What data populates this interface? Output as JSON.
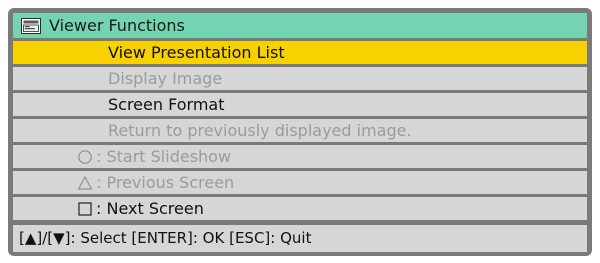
{
  "title_bar": {
    "title": "Viewer Functions",
    "icon": "viewer-icon"
  },
  "menu": {
    "items": [
      {
        "label": "View Presentation List",
        "state": "selected"
      },
      {
        "label": "Display Image",
        "state": "disabled"
      },
      {
        "label": "Screen Format",
        "state": "enabled"
      },
      {
        "label": "Return to previously displayed image.",
        "state": "disabled"
      },
      {
        "button_icon": "circle-button-icon",
        "label": ": Start Slideshow",
        "state": "disabled"
      },
      {
        "button_icon": "triangle-button-icon",
        "label": ": Previous Screen",
        "state": "disabled"
      },
      {
        "button_icon": "square-button-icon",
        "label": ": Next Screen",
        "state": "enabled"
      }
    ]
  },
  "footer": {
    "help_text": "[▲]/[▼]: Select  [ENTER]: OK  [ESC]: Quit"
  },
  "colors": {
    "frame": "#7a7a7a",
    "title_bar": "#74d3b0",
    "selected_row": "#f7d100",
    "row": "#d6d6d6",
    "disabled_text": "#9b9b9b",
    "text": "#111111"
  }
}
